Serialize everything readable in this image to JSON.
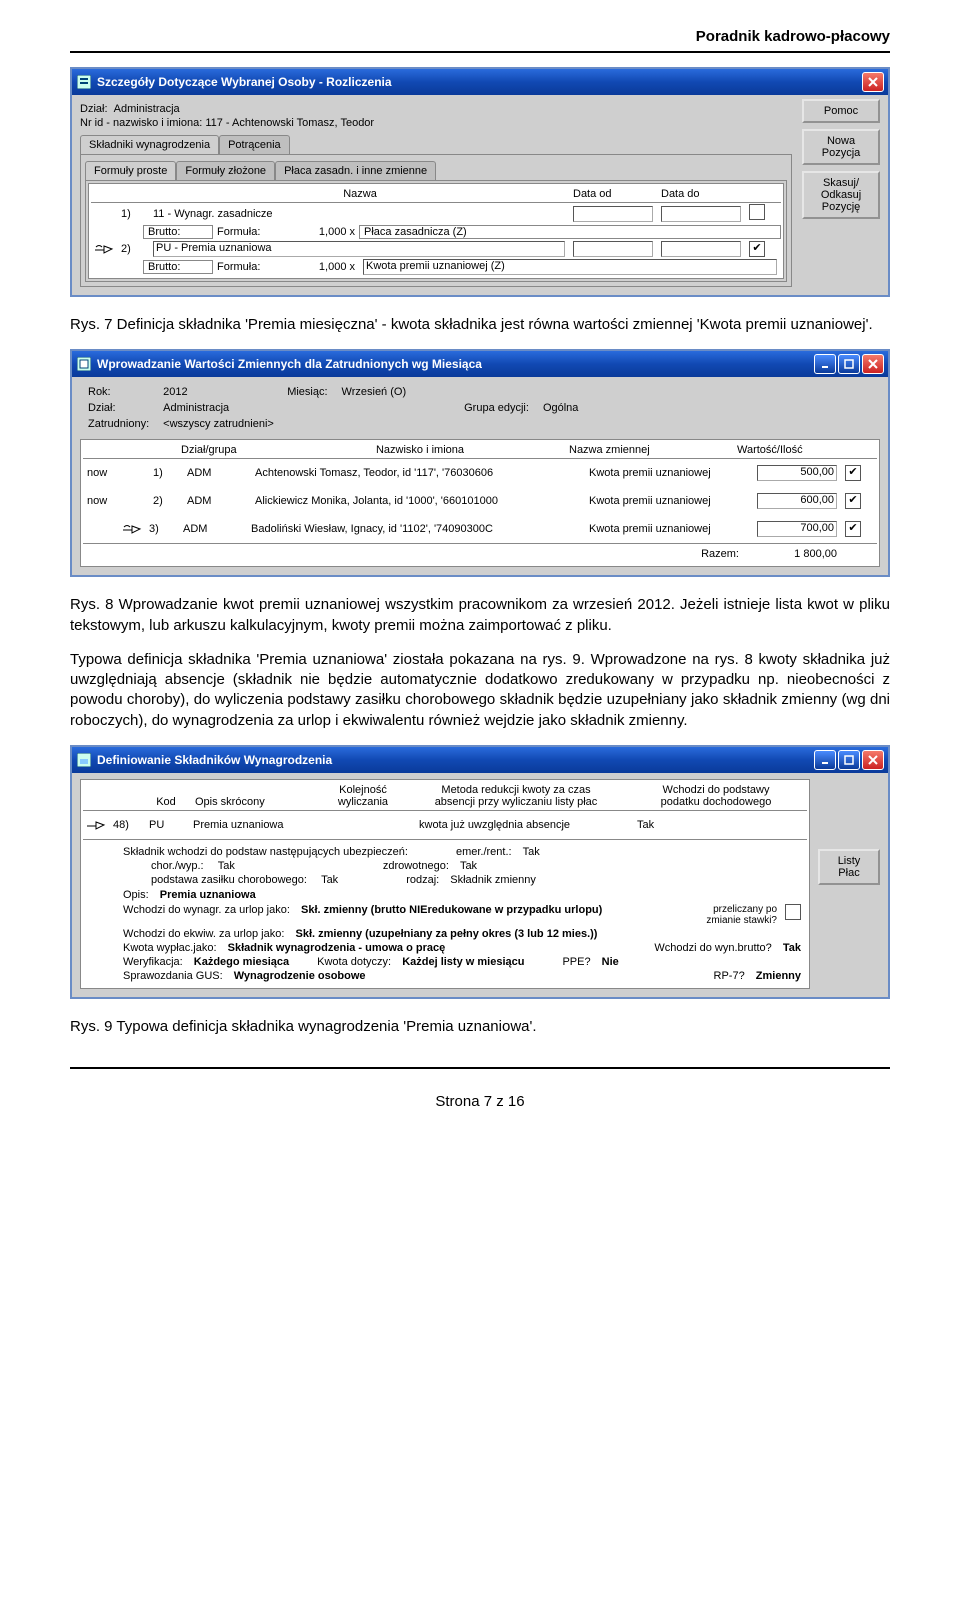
{
  "header": "Poradnik kadrowo-płacowy",
  "win1": {
    "title": "Szczegóły Dotyczące Wybranej Osoby - Rozliczenia",
    "dzial_lbl": "Dział:",
    "dzial": "Administracja",
    "nrid_lbl": "Nr id - nazwisko i imiona:",
    "nrid": "117 - Achtenowski Tomasz, Teodor",
    "btns": {
      "pomoc": "Pomoc",
      "nowa": "Nowa\nPozycja",
      "skasuj": "Skasuj/\nOdkasuj\nPozycję"
    },
    "tabs": {
      "sklad": "Składniki wynagrodzenia",
      "potr": "Potrącenia"
    },
    "subtabs": {
      "fp": "Formuły proste",
      "fz": "Formuły złożone",
      "pz": "Płaca zasadn. i inne zmienne"
    },
    "cols": {
      "nazwa": "Nazwa",
      "dod": "Data od",
      "ddo": "Data do"
    },
    "rows": [
      {
        "n": "1)",
        "code": "11 - Wynagr. zasadnicze",
        "bl": "Brutto:",
        "fl": "Formuła:",
        "f": "1,000 x",
        "fv": "Płaca zasadnicza (Z)",
        "d1": "",
        "d2": "",
        "chk": false
      },
      {
        "n": "2)",
        "code": "PU - Premia uznaniowa",
        "bl": "Brutto:",
        "fl": "Formuła:",
        "f": "1,000 x",
        "fv": "Kwota premii uznaniowej (Z)",
        "d1": "",
        "d2": "",
        "chk": true
      }
    ]
  },
  "cap1": "Rys. 7 Definicja składnika 'Premia miesięczna' - kwota składnika jest równa wartości zmiennej 'Kwota premii uznaniowej'.",
  "win2": {
    "title": "Wprowadzanie Wartości Zmiennych dla Zatrudnionych wg Miesiąca",
    "rok_l": "Rok:",
    "rok": "2012",
    "mies_l": "Miesiąc:",
    "mies": "Wrzesień (O)",
    "dzial_l": "Dział:",
    "dzial": "Administracja",
    "grupa_l": "Grupa edycji:",
    "grupa": "Ogólna",
    "zatr_l": "Zatrudniony:",
    "zatr": "<wszyscy zatrudnieni>",
    "cols": {
      "dg": "Dział/grupa",
      "ni": "Nazwisko i imiona",
      "nz": "Nazwa zmiennej",
      "wi": "Wartość/Ilość"
    },
    "rows": [
      {
        "s": "now",
        "n": "1)",
        "dg": "ADM",
        "ni": "Achtenowski Tomasz, Teodor, id '117', '76030606",
        "nz": "Kwota premii uznaniowej",
        "v": "500,00",
        "chk": true
      },
      {
        "s": "now",
        "n": "2)",
        "dg": "ADM",
        "ni": "Alickiewicz Monika, Jolanta, id '1000', '660101000",
        "nz": "Kwota premii uznaniowej",
        "v": "600,00",
        "chk": true
      },
      {
        "s": "",
        "n": "3)",
        "dg": "ADM",
        "ni": "Badoliński Wiesław, Ignacy, id '1102', '74090300C",
        "nz": "Kwota premii uznaniowej",
        "v": "700,00",
        "chk": true
      }
    ],
    "razem_l": "Razem:",
    "razem": "1 800,00"
  },
  "para1": "Rys. 8 Wprowadzanie kwot premii uznaniowej wszystkim pracownikom za wrzesień 2012. Jeżeli istnieje lista kwot w pliku tekstowym, lub arkuszu kalkulacyjnym, kwoty premii można zaimportować z pliku.",
  "para2": "Typowa definicja składnika 'Premia uznaniowa' ziostała pokazana na rys. 9. Wprowadzone na rys. 8 kwoty składnika już uwzględniają absencje (składnik nie będzie automatycznie dodatkowo zredukowany w przypadku np. nieobecności z powodu choroby), do wyliczenia podstawy zasiłku chorobowego składnik będzie uzupełniany jako składnik zmienny (wg dni roboczych), do wynagrodzenia za urlop i ekwiwalentu również wejdzie jako składnik zmienny.",
  "win3": {
    "title": "Definiowanie Składników Wynagrodzenia",
    "cols": {
      "kod": "Kod",
      "opis": "Opis skrócony",
      "kol": "Kolejność\nwyliczania",
      "met": "Metoda redukcji kwoty za czas\nabsencji przy wyliczaniu listy płac",
      "pod": "Wchodzi do podstawy\npodatku dochodowego"
    },
    "row": {
      "n": "48)",
      "kod": "PU",
      "opis": "Premia uznaniowa",
      "kol": "",
      "met": "kwota już uwzględnia absencje",
      "pod": "Tak"
    },
    "btn": "Listy\nPłac",
    "l1": "Składnik wchodzi do podstaw następujących ubezpieczeń:",
    "er_l": "emer./rent.:",
    "er": "Tak",
    "cw_l": "chor./wyp.:",
    "cw": "Tak",
    "zd_l": "zdrowotnego:",
    "zd": "Tak",
    "pz_l": "podstawa zasiłku chorobowego:",
    "pz": "Tak",
    "rod_l": "rodzaj:",
    "rod": "Składnik zmienny",
    "op_l": "Opis:",
    "op": "Premia uznaniowa",
    "wu_l": "Wchodzi do wynagr. za urlop jako:",
    "wu": "Skł. zmienny (brutto NIEredukowane w przypadku urlopu)",
    "prz_l": "przeliczany po\nzmianie stawki?",
    "we_l": "Wchodzi do ekwiw. za urlop jako:",
    "we": "Skł. zmienny (uzupełniany za pełny okres (3 lub 12 mies.))",
    "kw_l": "Kwota wypłac.jako:",
    "kw": "Składnik wynagrodzenia - umowa o pracę",
    "wb_l": "Wchodzi do wyn.brutto?",
    "wb": "Tak",
    "wer_l": "Weryfikacja:",
    "wer": "Każdego miesiąca",
    "kd_l": "Kwota dotyczy:",
    "kd": "Każdej listy w miesiącu",
    "ppe_l": "PPE?",
    "ppe": "Nie",
    "gus_l": "Sprawozdania GUS:",
    "gus": "Wynagrodzenie osobowe",
    "rp_l": "RP-7?",
    "rp": "Zmienny"
  },
  "cap3": "Rys. 9 Typowa definicja składnika wynagrodzenia 'Premia uznaniowa'.",
  "footer": "Strona 7 z 16"
}
